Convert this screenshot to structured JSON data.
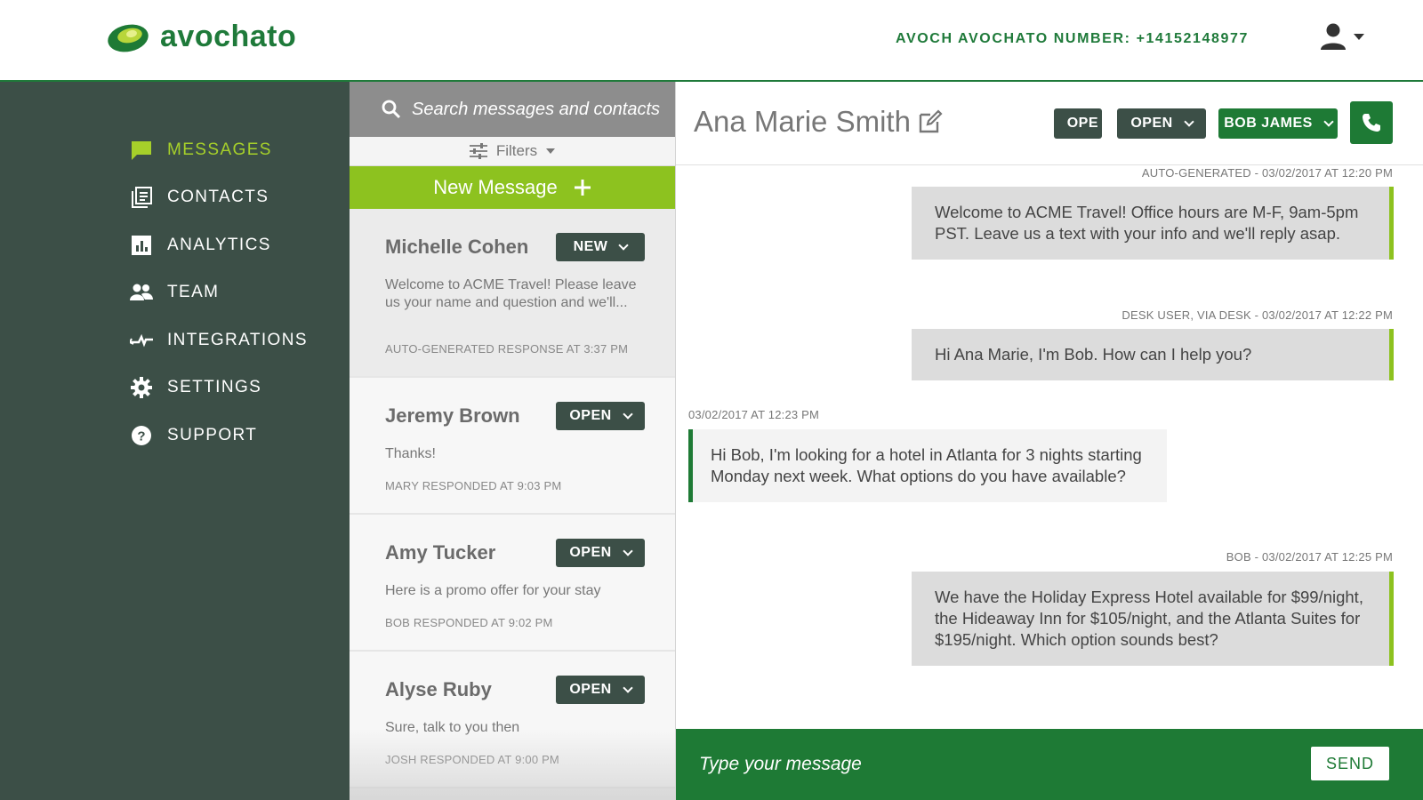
{
  "header": {
    "brand": "avochato",
    "number_label": "AVOCH  AVOCHATO NUMBER: +14152148977",
    "account_icon": "user-icon"
  },
  "nav": {
    "items": [
      {
        "label": "MESSAGES",
        "icon": "chat-bubble-icon",
        "active": true
      },
      {
        "label": "CONTACTS",
        "icon": "contacts-icon"
      },
      {
        "label": "ANALYTICS",
        "icon": "bar-chart-icon"
      },
      {
        "label": "TEAM",
        "icon": "team-icon"
      },
      {
        "label": "INTEGRATIONS",
        "icon": "integrations-icon"
      },
      {
        "label": "SETTINGS",
        "icon": "gear-icon"
      },
      {
        "label": "SUPPORT",
        "icon": "help-icon"
      }
    ]
  },
  "conversations": {
    "search_placeholder": "Search messages and contacts",
    "filters_label": "Filters",
    "new_message_label": "New Message",
    "items": [
      {
        "name": "Michelle Cohen",
        "status": "NEW",
        "preview": "Welcome to ACME Travel! Please leave us your name and question and we'll...",
        "meta": "AUTO-GENERATED RESPONSE AT 3:37 PM"
      },
      {
        "name": "Jeremy Brown",
        "status": "OPEN",
        "preview": "Thanks!",
        "meta": "MARY RESPONDED AT 9:03 PM"
      },
      {
        "name": "Amy Tucker",
        "status": "OPEN",
        "preview": "Here is a promo offer for your stay",
        "meta": "BOB RESPONDED AT 9:02 PM"
      },
      {
        "name": "Alyse Ruby",
        "status": "OPEN",
        "preview": "Sure, talk to you then",
        "meta": "JOSH RESPONDED AT 9:00 PM"
      }
    ]
  },
  "chat": {
    "contact_name": "Ana Marie Smith",
    "btn_partial": "OPE",
    "btn_status": "OPEN",
    "btn_assignee": "BOB JAMES",
    "messages": [
      {
        "direction": "out",
        "meta": "AUTO-GENERATED - 03/02/2017 AT 12:20 PM",
        "text": "Welcome to ACME Travel! Office hours are M-F, 9am-5pm PST. Leave us a text with your info and we'll reply asap."
      },
      {
        "direction": "out",
        "meta": "DESK USER, VIA DESK - 03/02/2017 AT 12:22 PM",
        "text": "Hi Ana Marie, I'm Bob. How can I help you?"
      },
      {
        "direction": "in",
        "meta": "03/02/2017 AT 12:23 PM",
        "text": "Hi Bob, I'm looking for a hotel in Atlanta for 3 nights starting Monday next week. What options do you have available?"
      },
      {
        "direction": "out",
        "meta": "BOB - 03/02/2017 AT 12:25 PM",
        "text": "We have the Holiday Express Hotel available for $99/night, the Hideaway Inn for $105/night, and the Atlanta Suites for $195/night. Which option sounds best?"
      }
    ],
    "compose_placeholder": "Type your message",
    "send_label": "SEND"
  },
  "colors": {
    "brand_green": "#1e7a35",
    "accent_lime": "#8dc21f",
    "nav_bg": "#3c4f47"
  }
}
